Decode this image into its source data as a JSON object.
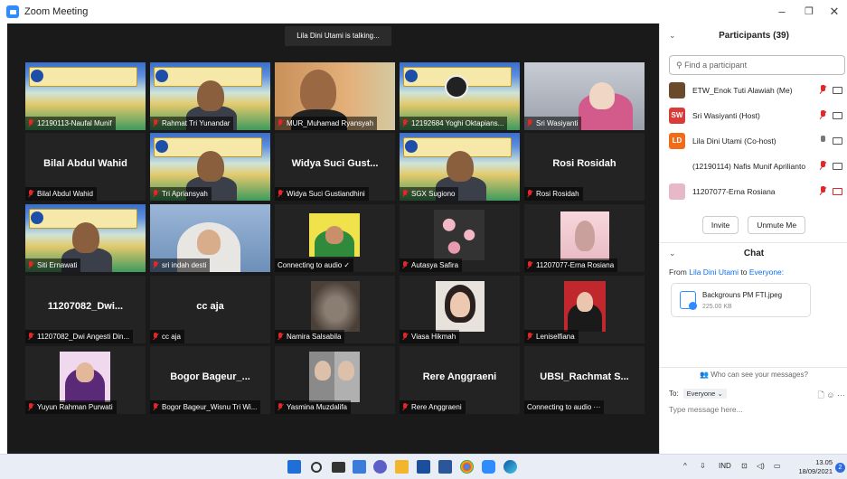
{
  "window": {
    "title": "Zoom Meeting",
    "minimize": "–",
    "maximize": "❐",
    "close": "✕"
  },
  "meeting": {
    "talking_banner": "Lila Dini Utami is talking..."
  },
  "tiles": [
    {
      "label": "12190113-Naufal Munif",
      "muted": true,
      "kind": "banner"
    },
    {
      "label": "Rahmat Tri Yunandar",
      "muted": true,
      "kind": "banner-person"
    },
    {
      "label": "MUR_Muhamad Ryansyah",
      "muted": true,
      "kind": "person-orange"
    },
    {
      "label": "12192684 Yoghi Oktapians...",
      "muted": true,
      "kind": "banner-obs"
    },
    {
      "label": "Sri Wasiyanti",
      "muted": true,
      "kind": "person-room"
    },
    {
      "label": "Bilal Abdul Wahid",
      "muted": true,
      "kind": "name",
      "big_name": "Bilal Abdul Wahid"
    },
    {
      "label": "Tri Apriansyah",
      "muted": true,
      "kind": "banner-person"
    },
    {
      "label": "Widya Suci Gustiandhini",
      "muted": true,
      "kind": "name",
      "big_name": "Widya Suci Gust..."
    },
    {
      "label": "SGX Sugiono",
      "muted": true,
      "kind": "banner-person"
    },
    {
      "label": "Rosi Rosidah",
      "muted": true,
      "kind": "name",
      "big_name": "Rosi Rosidah"
    },
    {
      "label": "Siti Ernawati",
      "muted": true,
      "kind": "banner-person2"
    },
    {
      "label": "sri indah desti",
      "muted": true,
      "kind": "person-hijab"
    },
    {
      "label": "Connecting to audio ✓",
      "muted": false,
      "kind": "person-green"
    },
    {
      "label": "Autasya Safira",
      "muted": true,
      "kind": "flowers"
    },
    {
      "label": "11207077-Erna Rosiana",
      "muted": true,
      "kind": "pink-art"
    },
    {
      "label": "11207082_Dwi Angesti Din...",
      "muted": true,
      "kind": "name",
      "big_name": "11207082_Dwi..."
    },
    {
      "label": "cc aja",
      "muted": true,
      "kind": "name",
      "big_name": "cc aja"
    },
    {
      "label": "Namira Salsabila",
      "muted": true,
      "kind": "cat"
    },
    {
      "label": "Viasa Hikmah",
      "muted": true,
      "kind": "girl"
    },
    {
      "label": "Leniselfiana",
      "muted": true,
      "kind": "girl-red"
    },
    {
      "label": "Yuyun Rahman Purwati",
      "muted": true,
      "kind": "person-purple"
    },
    {
      "label": "Bogor Bageur_Wisnu Tri Wi...",
      "muted": true,
      "kind": "name",
      "big_name": "Bogor Bageur_..."
    },
    {
      "label": "Yasmina Muzdalifa",
      "muted": true,
      "kind": "two-girls"
    },
    {
      "label": "Rere Anggraeni",
      "muted": true,
      "kind": "name",
      "big_name": "Rere Anggraeni"
    },
    {
      "label": "Connecting to audio ···",
      "muted": false,
      "kind": "name",
      "big_name": "UBSI_Rachmat S..."
    }
  ],
  "participants": {
    "title": "Participants (39)",
    "search_placeholder": "Find a participant",
    "items": [
      {
        "name": "ETW_Enok Tuti Alawiah (Me)",
        "avatar": "",
        "avatar_color": "#6a4a2a",
        "mic": "muted",
        "cam": "normal"
      },
      {
        "name": "Sri Wasiyanti (Host)",
        "avatar": "SW",
        "avatar_color": "#d93a3a",
        "mic": "muted",
        "cam": "normal"
      },
      {
        "name": "Lila Dini Utami (Co-host)",
        "avatar": "LD",
        "avatar_color": "#ef6c1a",
        "mic": "on",
        "cam": "normal"
      },
      {
        "name": "(12190114) Nafis Munif Aprilianto",
        "avatar": "",
        "avatar_color": "#ffffff",
        "mic": "muted",
        "cam": "normal"
      },
      {
        "name": "11207077-Erna Rosiana",
        "avatar": "",
        "avatar_color": "#e6b8c8",
        "mic": "muted",
        "cam": "off"
      }
    ],
    "invite_label": "Invite",
    "unmute_label": "Unmute Me"
  },
  "chat": {
    "title": "Chat",
    "from_prefix": "From",
    "from_name": "Lila Dini Utami",
    "to_word": "to",
    "to_name": "Everyone:",
    "file_name": "Backgrouns PM FTI.jpeg",
    "file_size": "225.00 KB",
    "who_can_see": "Who can see your messages?",
    "to_label": "To:",
    "to_select": "Everyone ⌄",
    "input_placeholder": "Type message here..."
  },
  "taskbar": {
    "tray_lang": "IND",
    "time": "13.05",
    "date": "18/09/2021",
    "notifications": "2"
  }
}
